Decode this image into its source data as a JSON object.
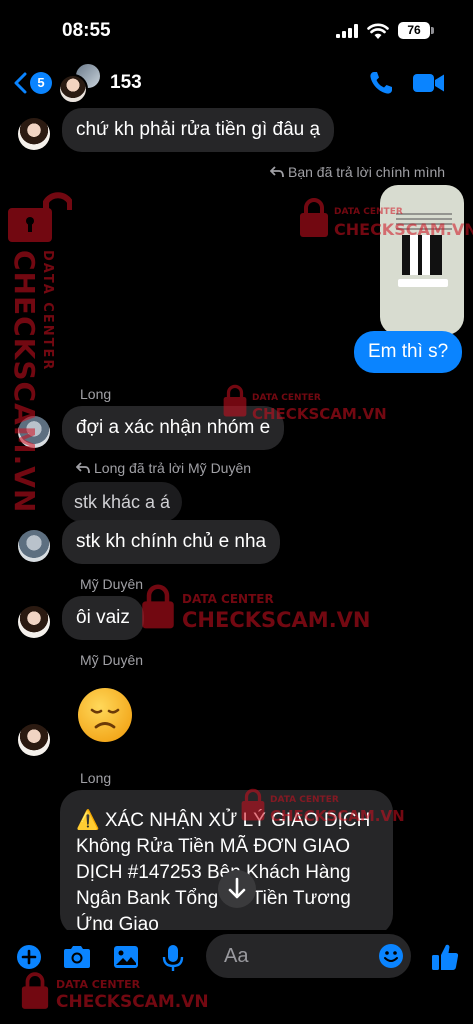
{
  "status_bar": {
    "time": "08:55",
    "battery": "76"
  },
  "header": {
    "back_badge": "5",
    "title": "153",
    "icons": [
      "back-chevron-icon",
      "phone-icon",
      "video-camera-icon"
    ]
  },
  "messages": {
    "m1": "chứ kh phải rửa tiền gì đâu ạ",
    "reply_note_1": "Bạn đã trả lời chính mình",
    "m_me": "Em thì s?",
    "sender_long_1": "Long",
    "m2": "đợi a xác nhận nhóm e",
    "reply_note_2": "Long đã trả lời Mỹ Duyên",
    "quoted": "stk khác a á",
    "m3": "stk kh chính chủ e nha",
    "sender_duyen_1": "Mỹ Duyên",
    "m4": "ôi vaiz",
    "sender_duyen_2": "Mỹ Duyên",
    "sender_long_2": "Long",
    "m5": "⚠️ XÁC NHẬN XỬ LÝ GIAO DỊCH Không Rửa Tiền MÃ ĐƠN GIAO DỊCH #147253 Bên Khách Hàng Ngân Bank Tổng Số Tiền Tương Ứng Giao"
  },
  "watermark": {
    "top_line": "DATA CENTER",
    "bottom_line": "CHECKSCAM.VN",
    "vertical": "CHECKSCAM.VN",
    "vertical_small": "DATA CENTER"
  },
  "composer": {
    "placeholder": "Aa"
  },
  "colors": {
    "accent": "#0a84ff",
    "bubble_gray": "#262628",
    "watermark_red": "#d0101f"
  }
}
